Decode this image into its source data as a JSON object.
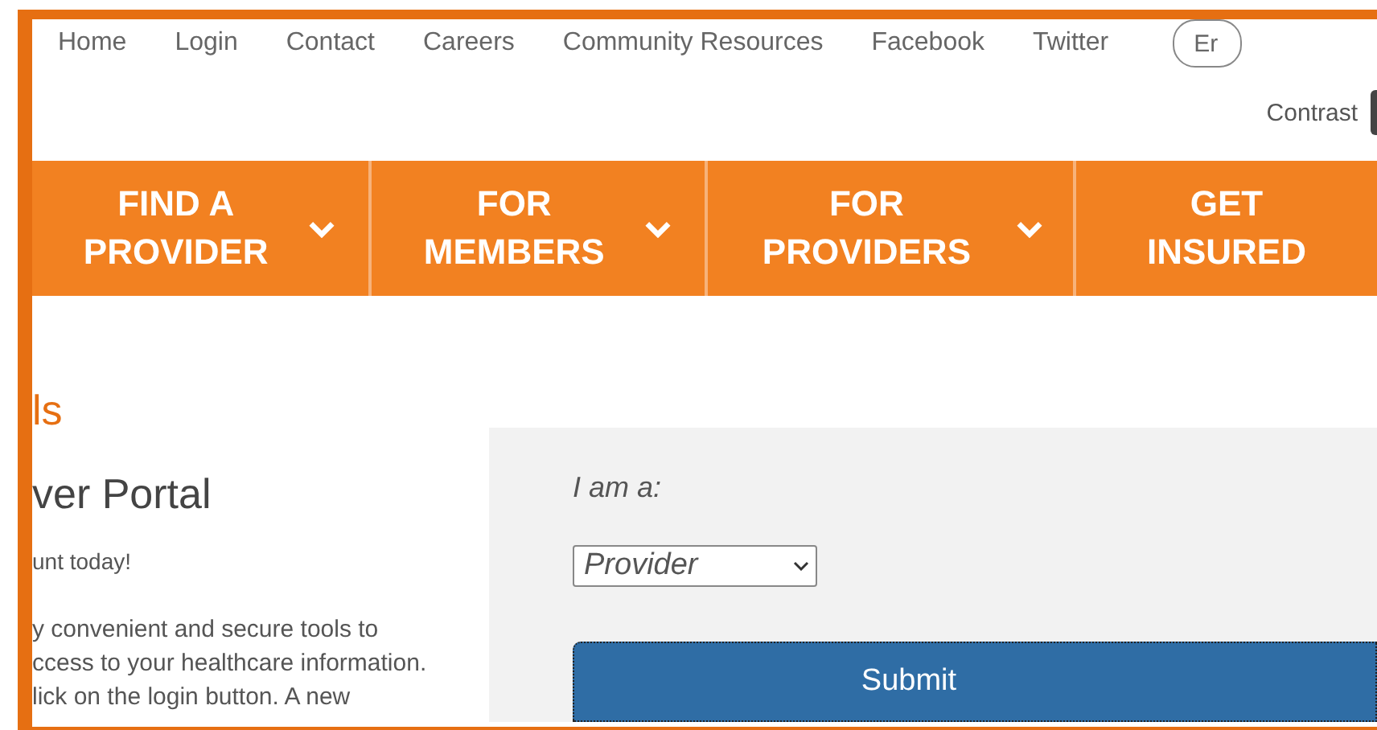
{
  "top_links": [
    "Home",
    "Login",
    "Contact",
    "Careers",
    "Community Resources",
    "Facebook",
    "Twitter"
  ],
  "language_button": "Er",
  "contrast_label": "Contrast",
  "main_nav": [
    {
      "label": "FIND A PROVIDER",
      "has_menu": true
    },
    {
      "label": "FOR MEMBERS",
      "has_menu": true
    },
    {
      "label": "FOR PROVIDERS",
      "has_menu": true
    },
    {
      "label": "GET INSURED",
      "has_menu": false
    }
  ],
  "section_title": "ls",
  "page_heading": "ver Portal",
  "intro": "unt today!",
  "body_lines": [
    "y convenient and secure tools to",
    "ccess to your healthcare information.",
    "lick on the login button. A new"
  ],
  "form": {
    "label": "I am a:",
    "role_select": "Provider",
    "submit": "Submit"
  }
}
